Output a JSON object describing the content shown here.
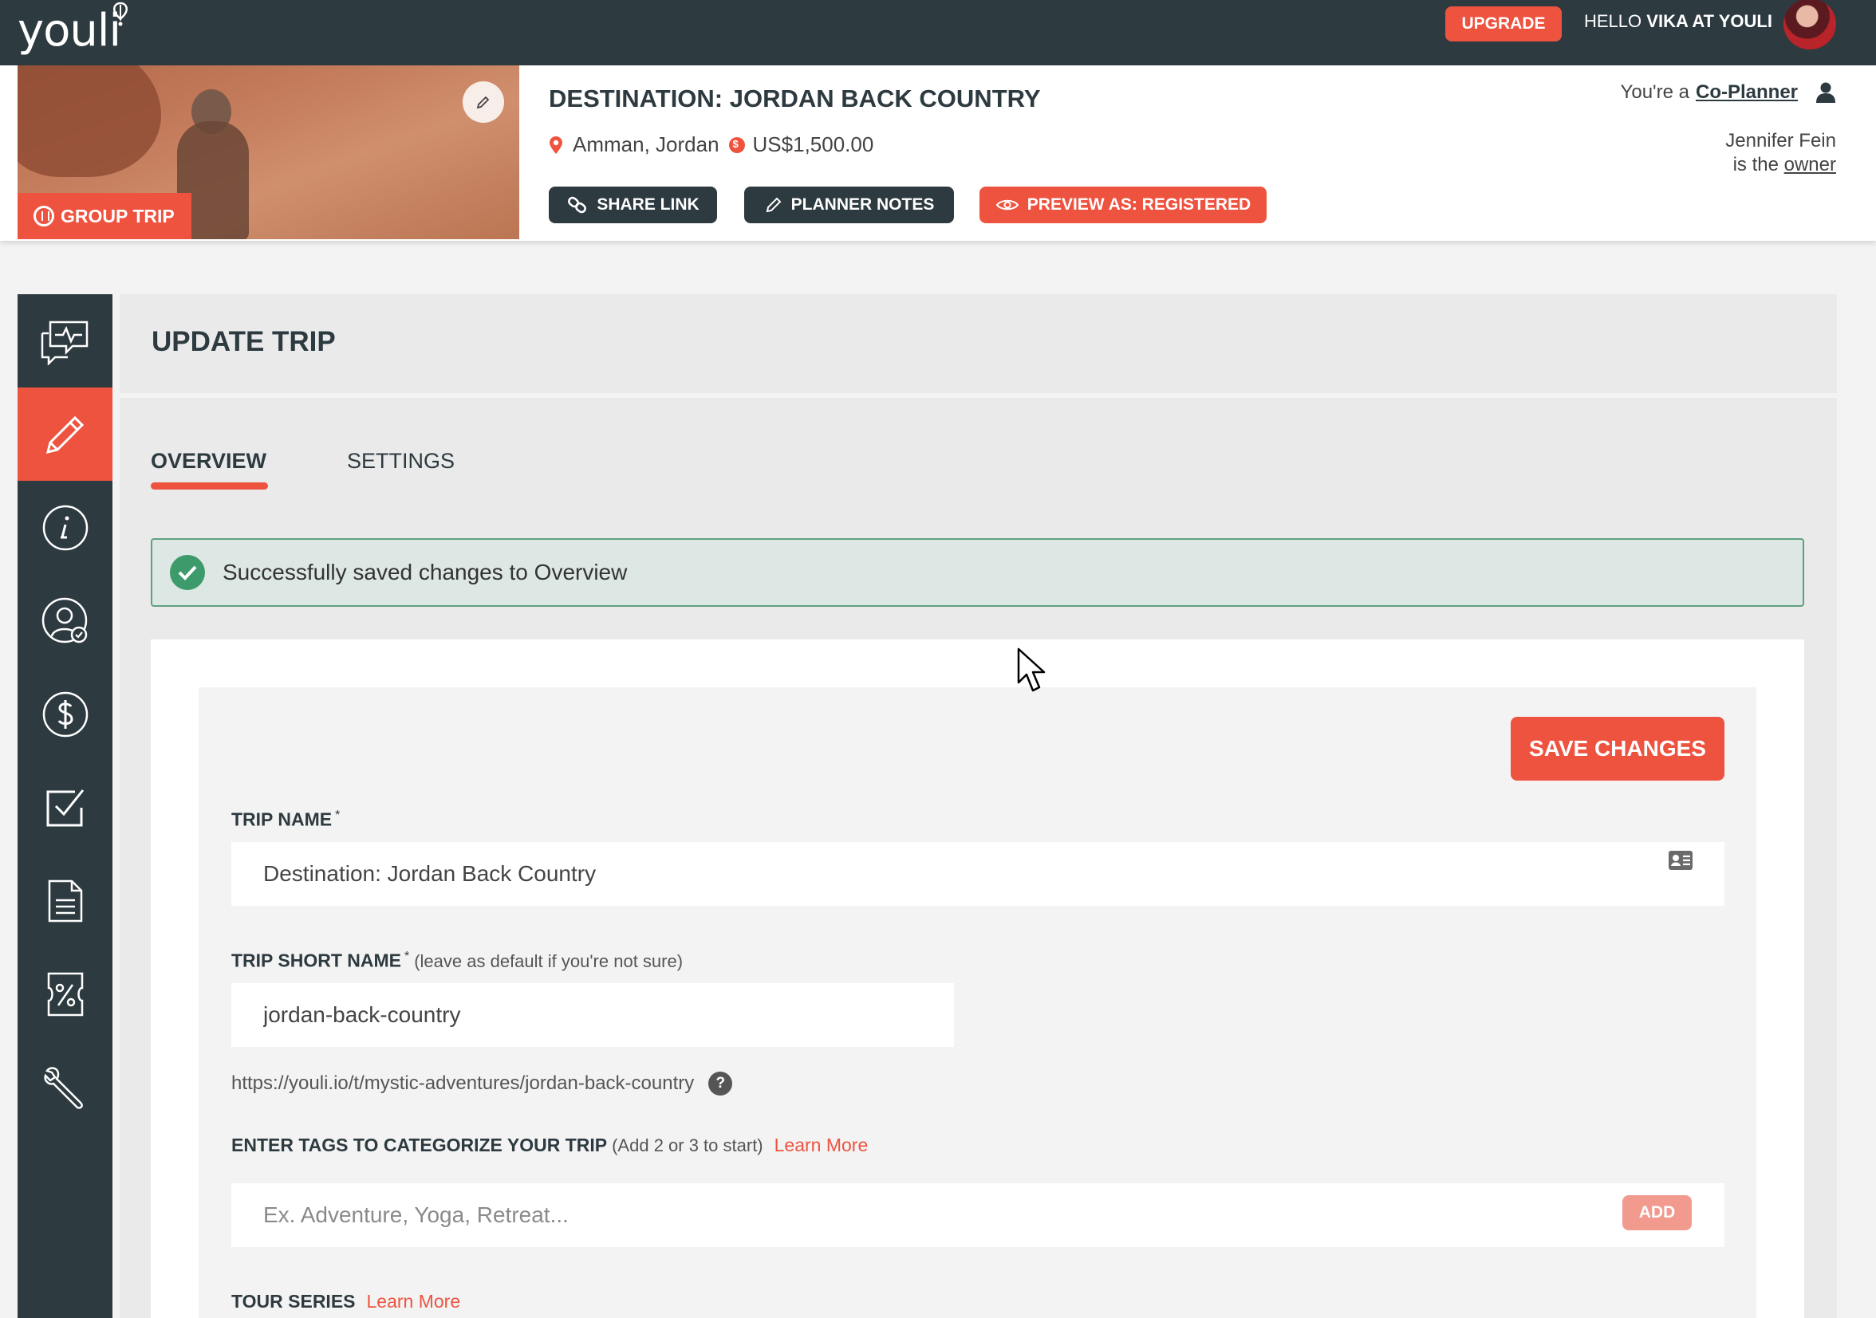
{
  "topbar": {
    "logo_text": "youli",
    "upgrade_label": "UPGRADE",
    "hello_prefix": "HELLO",
    "hello_name": "VIKA AT YOULI"
  },
  "trip": {
    "badge": "GROUP TRIP",
    "title": "DESTINATION: JORDAN BACK COUNTRY",
    "location": "Amman, Jordan",
    "price": "US$1,500.00",
    "buttons": {
      "share": "SHARE LINK",
      "notes": "PLANNER NOTES",
      "preview": "PREVIEW AS: REGISTERED"
    },
    "role_prefix": "You're a",
    "role": "Co-Planner",
    "owner_name": "Jennifer Fein",
    "owner_prefix": "is the",
    "owner_link": "owner"
  },
  "sidebar": {
    "items": [
      {
        "icon": "chat-activity-icon"
      },
      {
        "icon": "pencil-icon",
        "active": true
      },
      {
        "icon": "info-icon"
      },
      {
        "icon": "user-check-icon"
      },
      {
        "icon": "dollar-icon"
      },
      {
        "icon": "checkbox-icon"
      },
      {
        "icon": "document-icon"
      },
      {
        "icon": "coupon-percent-icon"
      },
      {
        "icon": "wrench-icon"
      }
    ]
  },
  "main": {
    "title": "UPDATE TRIP",
    "tabs": [
      {
        "label": "OVERVIEW",
        "active": true
      },
      {
        "label": "SETTINGS",
        "active": false
      }
    ],
    "alert": "Successfully saved changes to Overview"
  },
  "form": {
    "save_label": "SAVE CHANGES",
    "trip_name_label": "TRIP NAME",
    "required_mark": "*",
    "trip_name_value": "Destination: Jordan Back Country",
    "short_name_label": "TRIP SHORT NAME",
    "short_name_note": "(leave as default if you're not sure)",
    "short_name_value": "jordan-back-country",
    "url": "https://youli.io/t/mystic-adventures/jordan-back-country",
    "help_glyph": "?",
    "tags_label": "ENTER TAGS TO CATEGORIZE YOUR TRIP",
    "tags_note": "(Add 2 or 3 to start)",
    "learn_more": "Learn More",
    "tags_placeholder": "Ex. Adventure, Yoga, Retreat...",
    "add_label": "ADD",
    "tour_series_label": "TOUR SERIES"
  },
  "colors": {
    "accent": "#ee5340",
    "dark": "#2d3a40",
    "success": "#3d9a6b"
  }
}
